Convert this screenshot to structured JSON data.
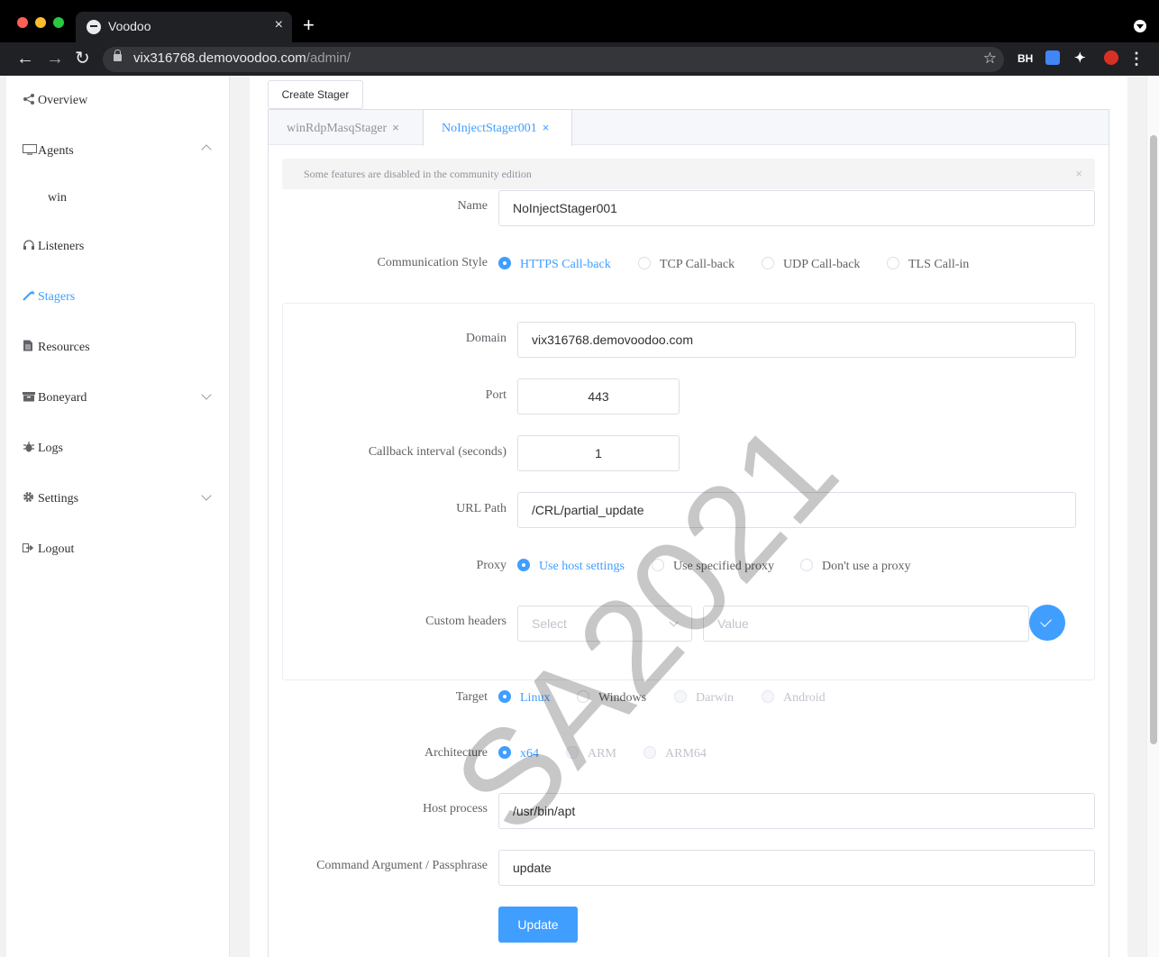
{
  "browser": {
    "tab_title": "Voodoo",
    "tab_close": "×",
    "new_tab": "+",
    "url_host": "vix316768.demovoodoo.com",
    "url_path": "/admin/",
    "ext_label": "BH"
  },
  "sidebar": {
    "items": [
      {
        "label": "Overview",
        "icon": "share-icon"
      },
      {
        "label": "Agents",
        "icon": "monitor-icon"
      },
      {
        "label": "Listeners",
        "icon": "headset-icon"
      },
      {
        "label": "Stagers",
        "icon": "magic-wand-icon"
      },
      {
        "label": "Resources",
        "icon": "document-icon"
      },
      {
        "label": "Boneyard",
        "icon": "box-icon"
      },
      {
        "label": "Logs",
        "icon": "bug-icon"
      },
      {
        "label": "Settings",
        "icon": "gear-icon"
      },
      {
        "label": "Logout",
        "icon": "logout-icon"
      }
    ],
    "agents_sub": "win"
  },
  "main": {
    "create_button": "Create Stager",
    "tabs": [
      {
        "label": "winRdpMasqStager",
        "close": "×"
      },
      {
        "label": "NoInjectStager001",
        "close": "×"
      }
    ],
    "alert": "Some features are disabled in the community edition",
    "alert_close": "×",
    "form": {
      "name_label": "Name",
      "name_value": "NoInjectStager001",
      "comm_label": "Communication Style",
      "comm_options": [
        "HTTPS Call-back",
        "TCP Call-back",
        "UDP Call-back",
        "TLS Call-in"
      ],
      "domain_label": "Domain",
      "domain_value": "vix316768.demovoodoo.com",
      "port_label": "Port",
      "port_value": "443",
      "interval_label": "Callback interval (seconds)",
      "interval_value": "1",
      "url_label": "URL Path",
      "url_value": "/CRL/partial_update",
      "proxy_label": "Proxy",
      "proxy_options": [
        "Use host settings",
        "Use specified proxy",
        "Don't use a proxy"
      ],
      "headers_label": "Custom headers",
      "headers_select_placeholder": "Select",
      "headers_value_placeholder": "Value",
      "target_label": "Target",
      "target_options": [
        "Linux",
        "Windows",
        "Darwin",
        "Android"
      ],
      "arch_label": "Architecture",
      "arch_options": [
        "x64",
        "ARM",
        "ARM64"
      ],
      "host_label": "Host process",
      "host_value": "/usr/bin/apt",
      "cmd_label": "Command Argument / Passphrase",
      "cmd_value": "update",
      "update_button": "Update"
    },
    "watermark": "SA2021"
  },
  "colors": {
    "accent": "#409eff",
    "text": "#606266",
    "border": "#dcdfe6"
  }
}
